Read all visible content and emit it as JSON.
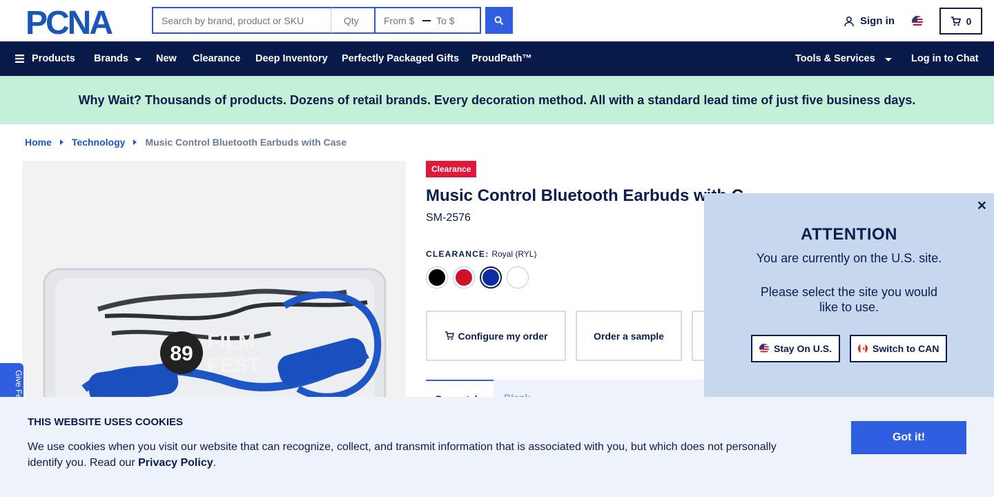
{
  "header": {
    "logo_text": "PCNA",
    "search": {
      "keyword_placeholder": "Search by brand, product or SKU",
      "qty_placeholder": "Qty",
      "from_placeholder": "From $",
      "to_placeholder": "To $"
    },
    "signin_label": "Sign in",
    "cart_count": "0"
  },
  "nav": {
    "products": "Products",
    "brands": "Brands",
    "new": "New",
    "clearance": "Clearance",
    "deep_inventory": "Deep Inventory",
    "gifts": "Perfectly Packaged Gifts",
    "proudpath": "ProudPath™",
    "tools": "Tools & Services",
    "chat": "Log in to Chat"
  },
  "banner": "Why Wait? Thousands of products. Dozens of retail brands. Every decoration method. All with a standard lead time of just five business days.",
  "breadcrumb": {
    "home": "Home",
    "category": "Technology",
    "current": "Music Control Bluetooth Earbuds with Case"
  },
  "product": {
    "badge": "Clearance",
    "title": "Music Control Bluetooth Earbuds with C",
    "sku": "SM-2576",
    "color_label": "CLEARANCE:",
    "color_value": "Royal (RYL)",
    "swatches": [
      "#000000",
      "#d0112b",
      "#0a2fa0",
      "#ffffff"
    ],
    "selected_swatch": 2,
    "image_text_1": "89",
    "image_text_2": "FILM",
    "image_text_3": "FEST",
    "actions": {
      "configure": "Configure my order",
      "sample": "Order a sample"
    },
    "tabs": {
      "active": "Promotal",
      "second": "Blank"
    }
  },
  "feedback_tab": "Give Fe",
  "popup": {
    "title": "ATTENTION",
    "line1": "You are currently on the U.S. site.",
    "line2": "Please select the site you would like to use.",
    "stay": "Stay On U.S.",
    "switch": "Switch to CAN"
  },
  "cookie": {
    "title": "THIS WEBSITE USES COOKIES",
    "text": "We use cookies when you visit our website that can recognize, collect, and transmit information that is associated with you, but which does not personally identify you. Read our ",
    "link": "Privacy Policy",
    "end": ".",
    "button": "Got it!"
  },
  "colors": {
    "navy": "#071a4a",
    "accent": "#2f5ee0",
    "banner": "#c3f0d6",
    "clearance_red": "#e0193a"
  }
}
